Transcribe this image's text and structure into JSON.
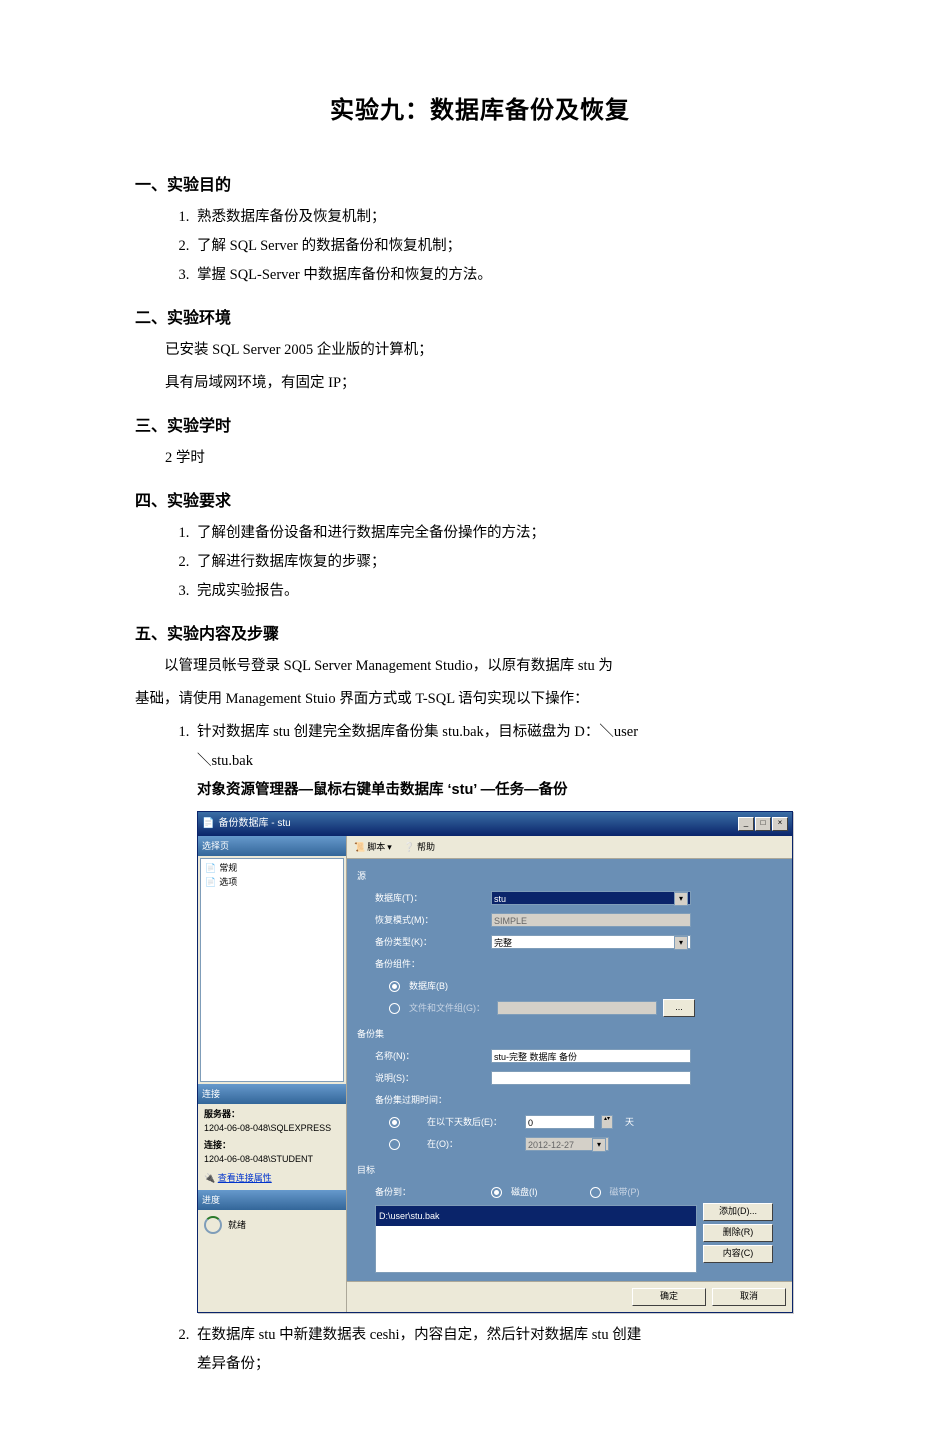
{
  "doc": {
    "title": "实验九：数据库备份及恢复",
    "s1": {
      "heading": "一、实验目的",
      "items": [
        "熟悉数据库备份及恢复机制；",
        "了解 SQL Server 的数据备份和恢复机制；",
        "掌握 SQL-Server 中数据库备份和恢复的方法。"
      ]
    },
    "s2": {
      "heading": "二、实验环境",
      "line1": "已安装 SQL Server 2005 企业版的计算机；",
      "line2": "具有局域网环境，有固定 IP；"
    },
    "s3": {
      "heading": "三、实验学时",
      "line": "2 学时"
    },
    "s4": {
      "heading": "四、实验要求",
      "items": [
        "了解创建备份设备和进行数据库完全备份操作的方法；",
        "了解进行数据库恢复的步骤；",
        "完成实验报告。"
      ]
    },
    "s5": {
      "heading": "五、实验内容及步骤",
      "intro1": "以管理员帐号登录 SQL Server Management Studio，以原有数据库 stu 为",
      "intro2": "基础，请使用 Management Stuio 界面方式或 T-SQL 语句实现以下操作：",
      "items": [
        "针对数据库 stu 创建完全数据库备份集 stu.bak，目标磁盘为 D：＼user",
        "在数据库 stu 中新建数据表 ceshi，内容自定，然后针对数据库 stu 创建"
      ],
      "item1_line2": "＼stu.bak",
      "item1_line3": "对象资源管理器—鼠标右键单击数据库 ‘stu’ —任务—备份",
      "item2_line2": "差异备份；"
    }
  },
  "dlg": {
    "title": "备份数据库 - stu",
    "pages_head": "选择页",
    "page_general": "常规",
    "page_options": "选项",
    "conn_head": "连接",
    "server_label": "服务器：",
    "server_value": "1204-06-08-048\\SQLEXPRESS",
    "conn_label": "连接：",
    "conn_value": "1204-06-08-048\\STUDENT",
    "view_conn": "查看连接属性",
    "progress_head": "进度",
    "progress_text": "就绪",
    "tb_script": "脚本",
    "tb_help": "帮助",
    "src_group": "源",
    "db_label": "数据库(T)：",
    "db_value": "stu",
    "model_label": "恢复模式(M)：",
    "model_value": "SIMPLE",
    "type_label": "备份类型(K)：",
    "type_value": "完整",
    "comp_label": "备份组件：",
    "comp_db": "数据库(B)",
    "comp_fg": "文件和文件组(G)：",
    "set_group": "备份集",
    "name_label": "名称(N)：",
    "name_value": "stu-完整 数据库 备份",
    "desc_label": "说明(S)：",
    "expire_label": "备份集过期时间：",
    "expire_days_label": "在以下天数后(E)：",
    "expire_days_value": "0",
    "days_unit": "天",
    "expire_on_label": "在(O)：",
    "expire_on_value": "2012-12-27",
    "dest_group": "目标",
    "dest_label": "备份到：",
    "dest_disk": "磁盘(I)",
    "dest_tape": "磁带(P)",
    "dest_path": "D:\\user\\stu.bak",
    "btn_add": "添加(D)...",
    "btn_remove": "删除(R)",
    "btn_content": "内容(C)",
    "btn_ok": "确定",
    "btn_cancel": "取消"
  }
}
